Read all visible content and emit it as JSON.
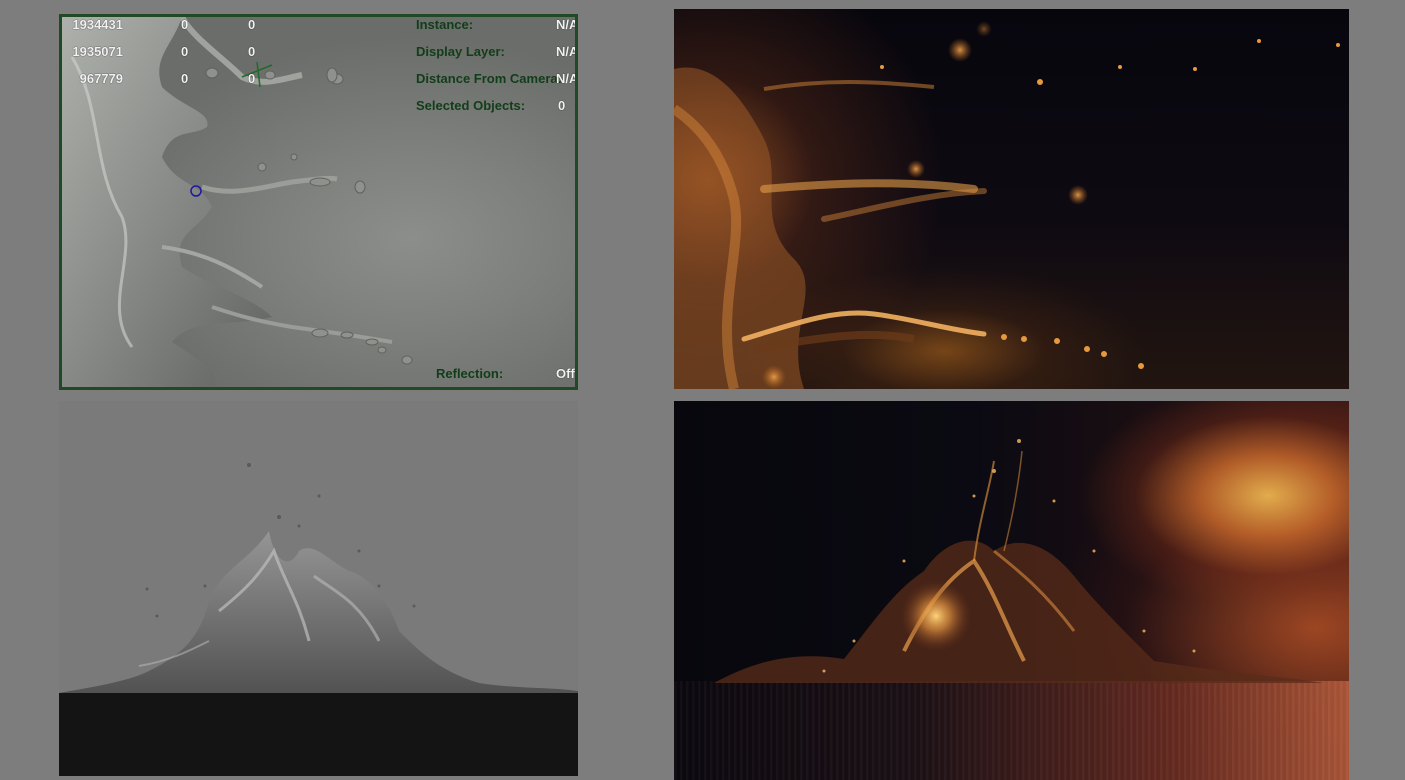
{
  "viewport": {
    "stats": [
      {
        "count": "1934431",
        "col2": "0",
        "col3": "0"
      },
      {
        "count": "1935071",
        "col2": "0",
        "col3": "0"
      },
      {
        "count": "967779",
        "col2": "0",
        "col3": "0"
      }
    ],
    "info": [
      {
        "label": "Instance:",
        "value": "N/A"
      },
      {
        "label": "Display Layer:",
        "value": "N/A"
      },
      {
        "label": "Distance From Camera:",
        "value": "N/A"
      },
      {
        "label": "Selected Objects:",
        "value": "0"
      }
    ],
    "reflection": {
      "label": "Reflection:",
      "value": "Off"
    }
  },
  "colors": {
    "background": "#7d7d7d",
    "viewport_border": "#1f4a25",
    "hud_green": "#123d1a",
    "hud_white": "#f2f2f2",
    "amber": "#e79a3c"
  }
}
